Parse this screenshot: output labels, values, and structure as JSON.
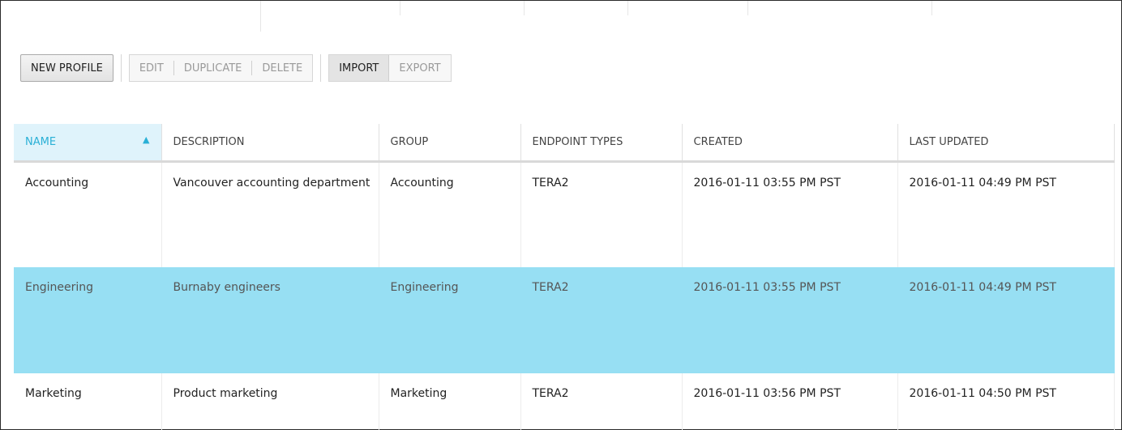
{
  "toolbar": {
    "new_profile": "NEW PROFILE",
    "edit": "EDIT",
    "duplicate": "DUPLICATE",
    "delete": "DELETE",
    "import": "IMPORT",
    "export": "EXPORT"
  },
  "table": {
    "columns": [
      "NAME",
      "DESCRIPTION",
      "GROUP",
      "ENDPOINT TYPES",
      "CREATED",
      "LAST UPDATED"
    ],
    "sorted_column": "NAME",
    "rows": [
      {
        "name": "Accounting",
        "description": "Vancouver accounting department",
        "group": "Accounting",
        "endpoint_types": "TERA2",
        "created": "2016-01-11 03:55 PM PST",
        "last_updated": "2016-01-11 04:49 PM PST"
      },
      {
        "name": "Engineering",
        "description": "Burnaby engineers",
        "group": "Engineering",
        "endpoint_types": "TERA2",
        "created": "2016-01-11 03:55 PM PST",
        "last_updated": "2016-01-11 04:49 PM PST"
      },
      {
        "name": "Marketing",
        "description": "Product marketing",
        "group": "Marketing",
        "endpoint_types": "TERA2",
        "created": "2016-01-11 03:56 PM PST",
        "last_updated": "2016-01-11 04:50 PM PST"
      }
    ],
    "selected_row": 1
  },
  "colors": {
    "accent": "#2ab0d6",
    "selected_row": "#97dff3",
    "sorted_header": "#dff3fb"
  }
}
